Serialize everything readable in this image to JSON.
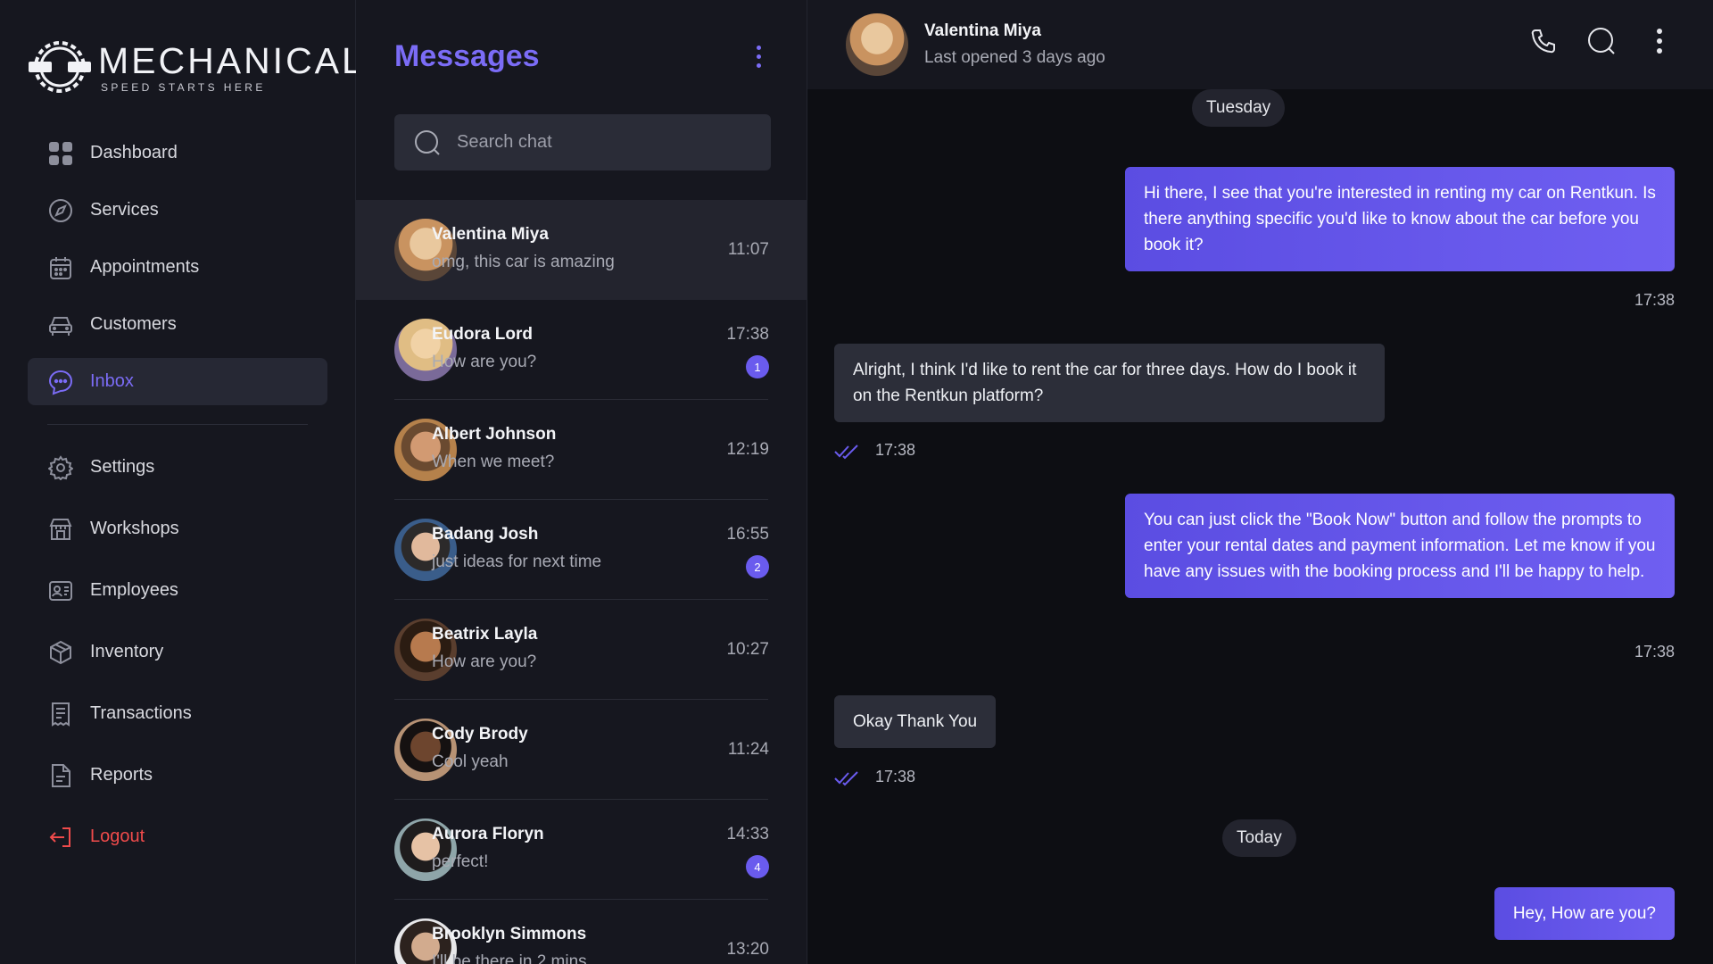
{
  "brand": {
    "title": "MECHANICAL",
    "tagline": "SPEED STARTS HERE"
  },
  "sidebar": {
    "items": [
      {
        "label": "Dashboard",
        "icon": "grid-icon"
      },
      {
        "label": "Services",
        "icon": "compass-icon"
      },
      {
        "label": "Appointments",
        "icon": "calendar-icon"
      },
      {
        "label": "Customers",
        "icon": "car-icon"
      },
      {
        "label": "Inbox",
        "icon": "chat-icon",
        "active": true
      }
    ],
    "items2": [
      {
        "label": "Settings",
        "icon": "gear-icon"
      },
      {
        "label": "Workshops",
        "icon": "shop-icon"
      },
      {
        "label": "Employees",
        "icon": "id-card-icon"
      },
      {
        "label": "Inventory",
        "icon": "box-icon"
      },
      {
        "label": "Transactions",
        "icon": "receipt-icon"
      },
      {
        "label": "Reports",
        "icon": "document-icon"
      }
    ],
    "logout": "Logout"
  },
  "messages": {
    "title": "Messages",
    "search_placeholder": "Search chat",
    "conversations": [
      {
        "name": "Valentina Miya",
        "preview": "omg, this car is amazing",
        "time": "11:07"
      },
      {
        "name": "Eudora Lord",
        "preview": "How are you?",
        "time": "17:38",
        "unread": "1"
      },
      {
        "name": "Albert Johnson",
        "preview": "When we meet?",
        "time": "12:19"
      },
      {
        "name": "Badang Josh",
        "preview": "just ideas for next time",
        "time": "16:55",
        "unread": "2"
      },
      {
        "name": "Beatrix Layla",
        "preview": "How are you?",
        "time": "10:27"
      },
      {
        "name": "Cody Brody",
        "preview": "Cool yeah",
        "time": "11:24"
      },
      {
        "name": "Aurora Floryn",
        "preview": "perfect!",
        "time": "14:33",
        "unread": "4"
      },
      {
        "name": "Brooklyn Simmons",
        "preview": "I'll be there in 2 mins",
        "time": "13:20"
      }
    ]
  },
  "chat": {
    "contact_name": "Valentina Miya",
    "status": "Last opened 3 days ago",
    "day1": "Tuesday",
    "day2": "Today",
    "msgs": [
      {
        "text": "Hi there, I see that you're interested in renting my car on Rentkun. Is there anything specific you'd like to know about the car before you book it?",
        "time": "17:38"
      },
      {
        "text": "Alright, I think I'd like to rent the car for three days. How do I book it on the Rentkun platform?",
        "time": "17:38"
      },
      {
        "text": "You can just click the \"Book Now\" button and follow the prompts to enter your rental dates and payment information. Let me know if you have any issues with the booking process and I'll be happy to help.",
        "time": "17:38"
      },
      {
        "text": "Okay Thank You",
        "time": "17:38"
      },
      {
        "text": "Hey, How are you?"
      }
    ]
  },
  "colors": {
    "accent": "#7b6cf6",
    "danger": "#f04b4b",
    "background": "#0d0e13",
    "panel": "#16171f"
  }
}
